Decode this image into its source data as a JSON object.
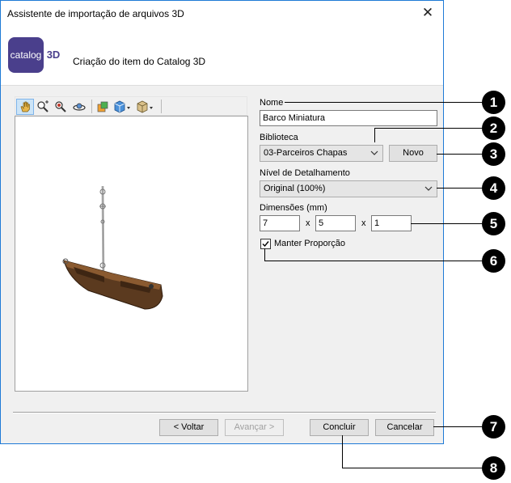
{
  "window": {
    "title": "Assistente de importação de arquivos 3D",
    "close_glyph": "✕"
  },
  "header": {
    "logo_text": "catalog",
    "logo_badge": "3D",
    "logo_color": "#4a3f8c",
    "title": "Criação do item do Catalog 3D"
  },
  "toolbar": {
    "icons": [
      "pan-hand-icon",
      "zoom-plus-icon",
      "zoom-icon",
      "orbit-icon",
      "material-icon",
      "cube-view-icon",
      "box-icon"
    ]
  },
  "form": {
    "name_label": "Nome",
    "name_value": "Barco Miniatura",
    "library_label": "Biblioteca",
    "library_value": "03-Parceiros Chapas",
    "new_button": "Novo",
    "detail_label": "Nível de Detalhamento",
    "detail_value": "Original (100%)",
    "dimensions_label": "Dimensões (mm)",
    "dim_x": "7",
    "dim_y": "5",
    "dim_z": "1",
    "times": "x",
    "keep_proportion_label": "Manter Proporção",
    "keep_proportion_checked": true
  },
  "footer": {
    "back": "< Voltar",
    "next": "Avançar >",
    "finish": "Concluir",
    "cancel": "Cancelar"
  },
  "callouts": [
    "1",
    "2",
    "3",
    "4",
    "5",
    "6",
    "7",
    "8"
  ],
  "colors": {
    "window_border": "#1e7ad6",
    "boat_hull": "#5b3a1f"
  }
}
